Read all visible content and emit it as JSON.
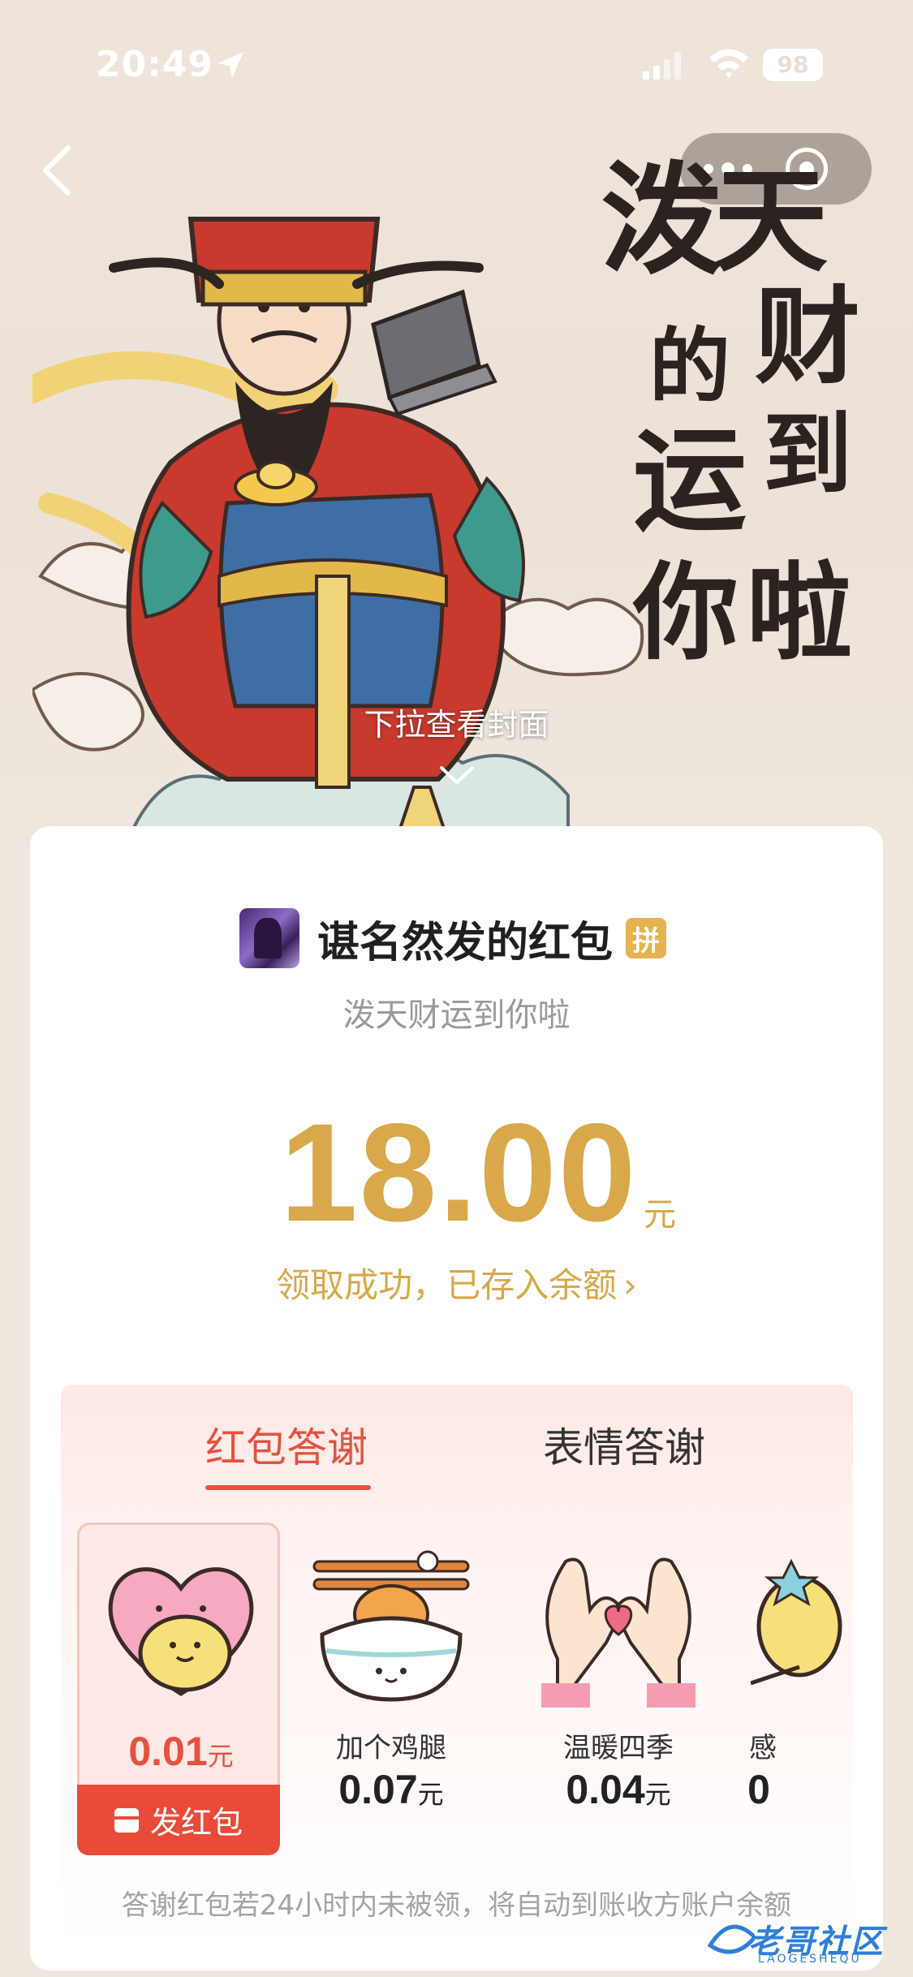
{
  "status_bar": {
    "time": "20:49",
    "battery": "98"
  },
  "hero": {
    "slogan_chars": [
      "泼",
      "天",
      "财",
      "的",
      "运",
      "到",
      "你",
      "啦"
    ],
    "pull_hint": "下拉查看封面"
  },
  "card": {
    "sender_name": "谌名然发的红包",
    "sender_badge": "拼",
    "greeting": "泼天财运到你啦",
    "amount": "18.00",
    "unit": "元",
    "success_text": "领取成功，已存入余额",
    "success_chevron": "›"
  },
  "thanks": {
    "tab_active": "红包答谢",
    "tab_inactive": "表情答谢",
    "gifts": [
      {
        "name": "",
        "price": "0.01",
        "unit": "元",
        "icon": "heart-hug-icon",
        "selected": true
      },
      {
        "name": "加个鸡腿",
        "price": "0.07",
        "unit": "元",
        "icon": "rice-bowl-drumstick-icon"
      },
      {
        "name": "温暖四季",
        "price": "0.04",
        "unit": "元",
        "icon": "hands-heart-icon"
      },
      {
        "name": "感",
        "price": "0",
        "unit": "",
        "icon": "partial-gift-icon"
      }
    ],
    "send_button": "发红包",
    "footnote": "答谢红包若24小时内未被领，将自动到账收方账户余额"
  },
  "watermark": {
    "text": "老哥社区",
    "sub": "LAOGESHEQU"
  },
  "colors": {
    "accent_red": "#e5523f",
    "gold": "#d8a84b",
    "button_red": "#ea4a38"
  }
}
